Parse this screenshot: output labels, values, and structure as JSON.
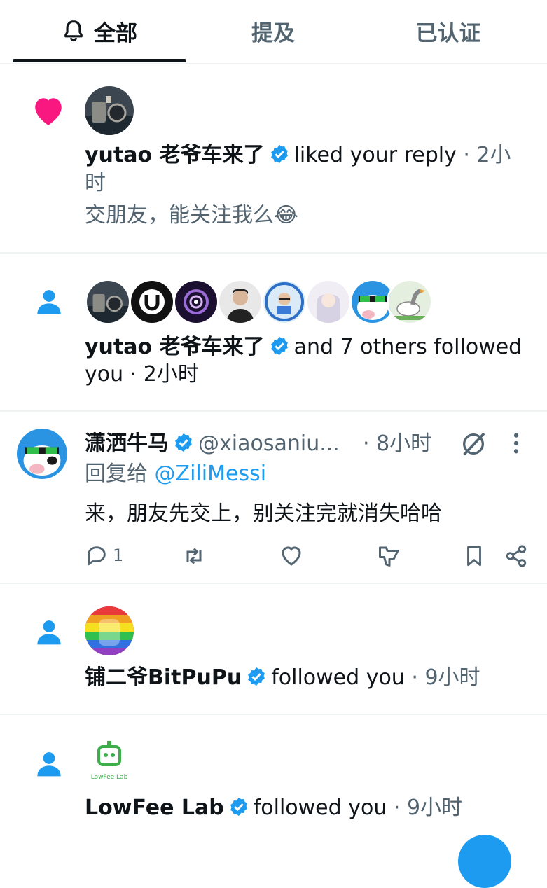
{
  "tabs": [
    {
      "label": "全部"
    },
    {
      "label": "提及"
    },
    {
      "label": "已认证"
    }
  ],
  "n1": {
    "name": "yutao 老爷车来了",
    "action": "liked your reply",
    "time_a": "· 2小",
    "time_b": "时",
    "content": "交朋友，能关注我么😂"
  },
  "n2": {
    "name": "yutao 老爷车来了",
    "action": "and 7 others followed",
    "line2": "you · 2小时"
  },
  "reply": {
    "name": "潇洒牛马",
    "handle": "@xiaosaniu...",
    "time": "· 8小时",
    "reply_to_label": "回复给",
    "reply_to_user": "@ZiliMessi",
    "content": "来，朋友先交上，别关注完就消失哈哈",
    "reply_count": "1"
  },
  "n3": {
    "name": "铺二爷BitPuPu",
    "action": "followed you",
    "time": "· 9小时"
  },
  "n4": {
    "name": "LowFee Lab",
    "action": "followed you",
    "time": "· 9小时",
    "logo_text": "LowFee Lab"
  },
  "colors": {
    "accent": "#1d9bf0",
    "like": "#f91880",
    "text": "#0f1419",
    "muted": "#536471"
  }
}
